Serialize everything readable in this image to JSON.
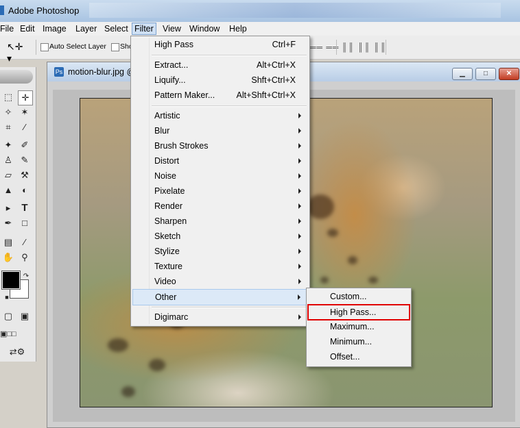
{
  "window": {
    "title": "Adobe Photoshop"
  },
  "menubar": {
    "items": [
      {
        "label": "File"
      },
      {
        "label": "Edit"
      },
      {
        "label": "Image"
      },
      {
        "label": "Layer"
      },
      {
        "label": "Select"
      },
      {
        "label": "Filter"
      },
      {
        "label": "View"
      },
      {
        "label": "Window"
      },
      {
        "label": "Help"
      }
    ]
  },
  "options": {
    "auto_select_label": "Auto Select Layer",
    "show_label": "Sho"
  },
  "document": {
    "title": "motion-blur.jpg @"
  },
  "filter_menu": {
    "last_filter": {
      "label": "High Pass",
      "shortcut": "Ctrl+F"
    },
    "group1": [
      {
        "label": "Extract...",
        "shortcut": "Alt+Ctrl+X"
      },
      {
        "label": "Liquify...",
        "shortcut": "Shft+Ctrl+X"
      },
      {
        "label": "Pattern Maker...",
        "shortcut": "Alt+Shft+Ctrl+X"
      }
    ],
    "group2": [
      {
        "label": "Artistic"
      },
      {
        "label": "Blur"
      },
      {
        "label": "Brush Strokes"
      },
      {
        "label": "Distort"
      },
      {
        "label": "Noise"
      },
      {
        "label": "Pixelate"
      },
      {
        "label": "Render"
      },
      {
        "label": "Sharpen"
      },
      {
        "label": "Sketch"
      },
      {
        "label": "Stylize"
      },
      {
        "label": "Texture"
      },
      {
        "label": "Video"
      },
      {
        "label": "Other"
      }
    ],
    "group3": [
      {
        "label": "Digimarc"
      }
    ]
  },
  "other_submenu": {
    "items": [
      {
        "label": "Custom..."
      },
      {
        "label": "High Pass..."
      },
      {
        "label": "Maximum..."
      },
      {
        "label": "Minimum..."
      },
      {
        "label": "Offset..."
      }
    ]
  },
  "colors": {
    "highlight_box": "#e00000",
    "menu_highlight": "#dce9f7"
  }
}
